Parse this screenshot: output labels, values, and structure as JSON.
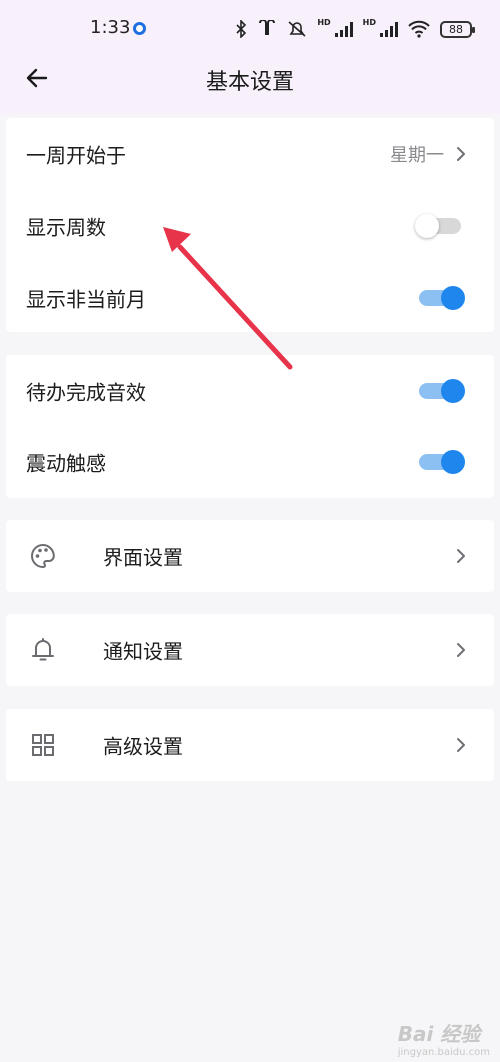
{
  "status_bar": {
    "time": "1:33",
    "battery": "88",
    "icons": [
      "bluetooth-icon",
      "earbuds-icon",
      "mute-icon",
      "signal-icon",
      "signal-icon",
      "wifi-icon",
      "battery-icon"
    ],
    "hd_label": "HD"
  },
  "header": {
    "title": "基本设置",
    "back_icon": "arrow-left-icon"
  },
  "group1": {
    "week_start": {
      "label": "一周开始于",
      "value": "星期一"
    },
    "show_week_number": {
      "label": "显示周数",
      "on": false
    },
    "show_non_current_month": {
      "label": "显示非当前月",
      "on": true
    }
  },
  "group2": {
    "todo_sound": {
      "label": "待办完成音效",
      "on": true
    },
    "vibration": {
      "label": "震动触感",
      "on": true
    }
  },
  "interface_settings": {
    "label": "界面设置",
    "icon": "palette-icon"
  },
  "notification_settings": {
    "label": "通知设置",
    "icon": "bell-icon"
  },
  "advanced_settings": {
    "label": "高级设置",
    "icon": "grid-icon"
  },
  "annotation": {
    "color": "#e8344a"
  },
  "colors": {
    "accent": "#1e86ec",
    "toggle_track_on": "#8cc0f3",
    "toggle_off": "#d8d8d8"
  },
  "watermark": {
    "main": "Bai 经验",
    "sub": "jingyan.baidu.com"
  }
}
